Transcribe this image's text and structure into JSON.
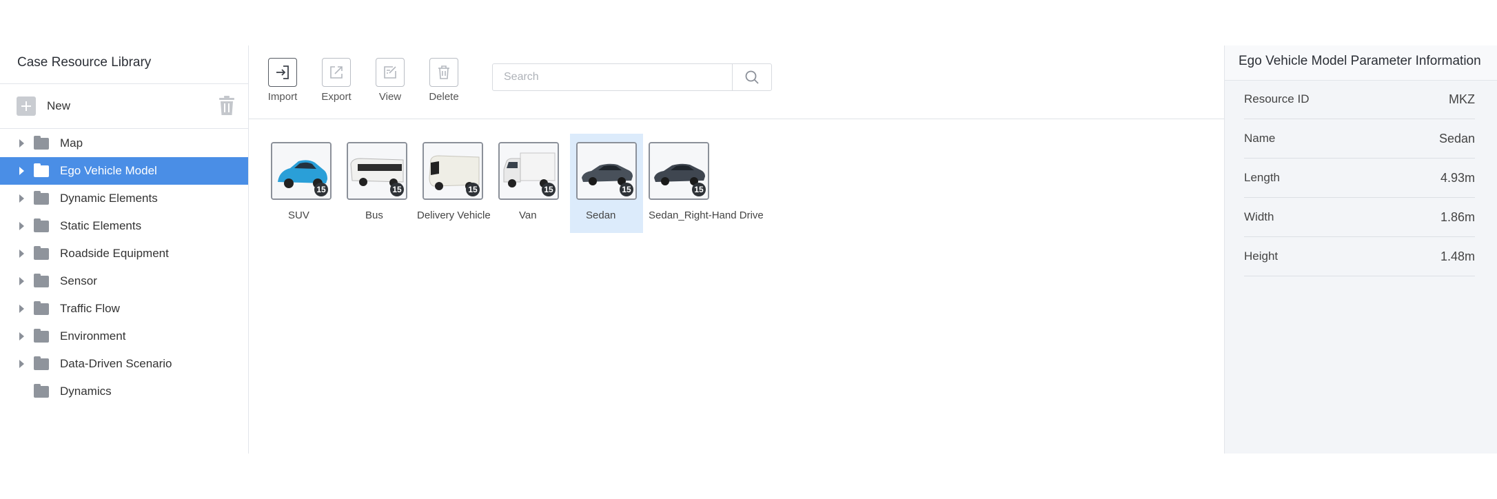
{
  "sidebar": {
    "title": "Case Resource Library",
    "new_label": "New",
    "items": [
      {
        "label": "Map",
        "has_children": true,
        "active": false
      },
      {
        "label": "Ego Vehicle Model",
        "has_children": true,
        "active": true
      },
      {
        "label": "Dynamic Elements",
        "has_children": true,
        "active": false
      },
      {
        "label": "Static Elements",
        "has_children": true,
        "active": false
      },
      {
        "label": "Roadside Equipment",
        "has_children": true,
        "active": false
      },
      {
        "label": "Sensor",
        "has_children": true,
        "active": false
      },
      {
        "label": "Traffic Flow",
        "has_children": true,
        "active": false
      },
      {
        "label": "Environment",
        "has_children": true,
        "active": false
      },
      {
        "label": "Data-Driven Scenario",
        "has_children": true,
        "active": false
      },
      {
        "label": "Dynamics",
        "has_children": false,
        "active": false
      }
    ]
  },
  "toolbar": {
    "import_label": "Import",
    "export_label": "Export",
    "view_label": "View",
    "delete_label": "Delete",
    "search_placeholder": "Search",
    "search_value": ""
  },
  "models": [
    {
      "label": "SUV",
      "count": "15",
      "color": "#2a9fd8",
      "shape": "suv"
    },
    {
      "label": "Bus",
      "count": "15",
      "color": "#f1f1ef",
      "shape": "bus"
    },
    {
      "label": "Delivery Vehicle",
      "count": "15",
      "color": "#efeee6",
      "shape": "delivery"
    },
    {
      "label": "Van",
      "count": "15",
      "color": "#f4f4f4",
      "shape": "truck"
    },
    {
      "label": "Sedan",
      "count": "15",
      "color": "#48505a",
      "shape": "sedan",
      "selected": true
    },
    {
      "label": "Sedan_Right-Hand Drive",
      "count": "15",
      "color": "#3f4650",
      "shape": "sedan"
    }
  ],
  "panel": {
    "title": "Ego Vehicle Model Parameter Information",
    "params": [
      {
        "key": "Resource ID",
        "value": "MKZ"
      },
      {
        "key": "Name",
        "value": "Sedan"
      },
      {
        "key": "Length",
        "value": "4.93m"
      },
      {
        "key": "Width",
        "value": "1.86m"
      },
      {
        "key": "Height",
        "value": "1.48m"
      }
    ]
  },
  "colors": {
    "accent": "#4a8ee6",
    "selected_card": "#dcebfb"
  }
}
